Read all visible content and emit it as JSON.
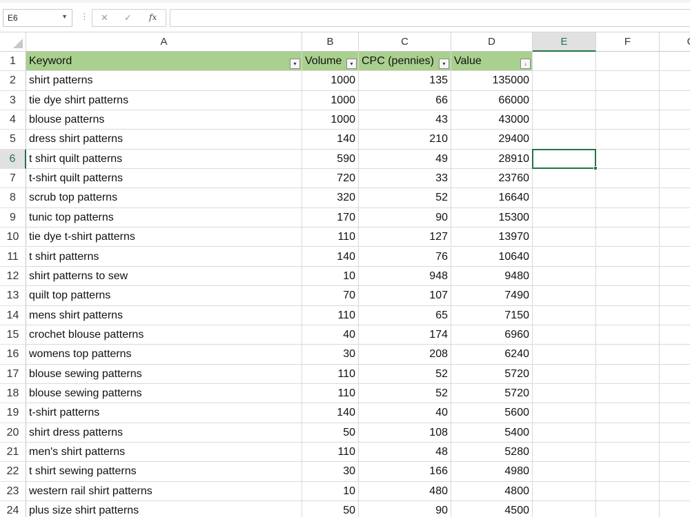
{
  "namebox": {
    "value": "E6"
  },
  "formula": {
    "fx": "fx",
    "value": ""
  },
  "columns": [
    "A",
    "B",
    "C",
    "D",
    "E",
    "F",
    "G"
  ],
  "selected_column": "E",
  "selected_row": 6,
  "header_row": {
    "row": "1",
    "keyword": "Keyword",
    "volume": "Volume",
    "cpc": "CPC (pennies)",
    "value": "Value"
  },
  "rows": [
    {
      "row": "2",
      "keyword": "shirt patterns",
      "volume": "1000",
      "cpc": "135",
      "value": "135000"
    },
    {
      "row": "3",
      "keyword": "tie dye shirt patterns",
      "volume": "1000",
      "cpc": "66",
      "value": "66000"
    },
    {
      "row": "4",
      "keyword": "blouse patterns",
      "volume": "1000",
      "cpc": "43",
      "value": "43000"
    },
    {
      "row": "5",
      "keyword": "dress shirt patterns",
      "volume": "140",
      "cpc": "210",
      "value": "29400"
    },
    {
      "row": "6",
      "keyword": "t shirt quilt patterns",
      "volume": "590",
      "cpc": "49",
      "value": "28910"
    },
    {
      "row": "7",
      "keyword": "t-shirt quilt patterns",
      "volume": "720",
      "cpc": "33",
      "value": "23760"
    },
    {
      "row": "8",
      "keyword": "scrub top patterns",
      "volume": "320",
      "cpc": "52",
      "value": "16640"
    },
    {
      "row": "9",
      "keyword": "tunic top patterns",
      "volume": "170",
      "cpc": "90",
      "value": "15300"
    },
    {
      "row": "10",
      "keyword": "tie dye t-shirt patterns",
      "volume": "110",
      "cpc": "127",
      "value": "13970"
    },
    {
      "row": "11",
      "keyword": "t shirt patterns",
      "volume": "140",
      "cpc": "76",
      "value": "10640"
    },
    {
      "row": "12",
      "keyword": "shirt patterns to sew",
      "volume": "10",
      "cpc": "948",
      "value": "9480"
    },
    {
      "row": "13",
      "keyword": "quilt top patterns",
      "volume": "70",
      "cpc": "107",
      "value": "7490"
    },
    {
      "row": "14",
      "keyword": "mens shirt patterns",
      "volume": "110",
      "cpc": "65",
      "value": "7150"
    },
    {
      "row": "15",
      "keyword": "crochet blouse patterns",
      "volume": "40",
      "cpc": "174",
      "value": "6960"
    },
    {
      "row": "16",
      "keyword": "womens top patterns",
      "volume": "30",
      "cpc": "208",
      "value": "6240"
    },
    {
      "row": "17",
      "keyword": "blouse sewing patterns",
      "volume": "110",
      "cpc": "52",
      "value": "5720"
    },
    {
      "row": "18",
      "keyword": "blouse sewing patterns",
      "volume": "110",
      "cpc": "52",
      "value": "5720"
    },
    {
      "row": "19",
      "keyword": "t-shirt patterns",
      "volume": "140",
      "cpc": "40",
      "value": "5600"
    },
    {
      "row": "20",
      "keyword": "shirt dress patterns",
      "volume": "50",
      "cpc": "108",
      "value": "5400"
    },
    {
      "row": "21",
      "keyword": "men's shirt patterns",
      "volume": "110",
      "cpc": "48",
      "value": "5280"
    },
    {
      "row": "22",
      "keyword": "t shirt sewing patterns",
      "volume": "30",
      "cpc": "166",
      "value": "4980"
    },
    {
      "row": "23",
      "keyword": "western rail shirt patterns",
      "volume": "10",
      "cpc": "480",
      "value": "4800"
    },
    {
      "row": "24",
      "keyword": "plus size shirt patterns",
      "volume": "50",
      "cpc": "90",
      "value": "4500"
    }
  ],
  "colors": {
    "header_fill": "#a9d08e",
    "accent": "#217346",
    "grid_line": "#d9d9d9"
  },
  "icons": {
    "cancel": "close-icon",
    "enter": "check-icon",
    "function": "fx-icon",
    "filter": "filter-dropdown-icon",
    "sort": "sort-descending-icon"
  }
}
